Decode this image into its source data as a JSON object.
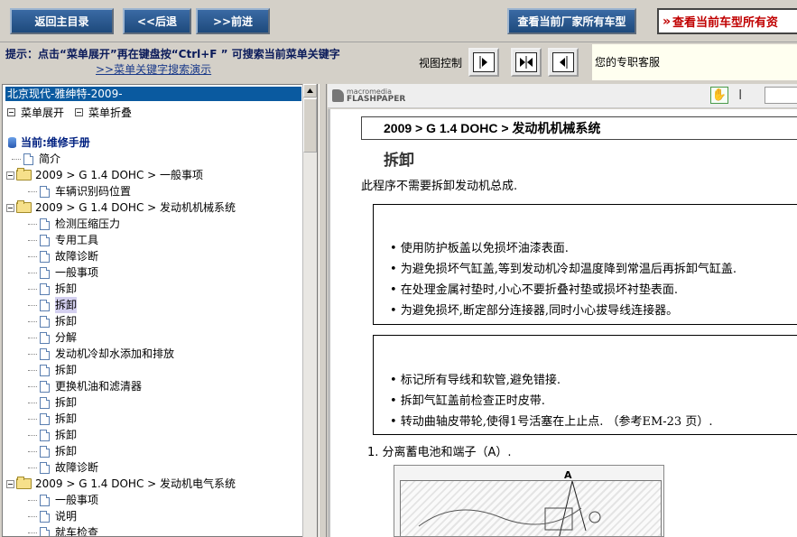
{
  "topbar": {
    "home": "返回主目录",
    "back": "<<后退",
    "forward": ">>前进",
    "all_makers": "查看当前厂家所有车型",
    "all_models": "查看当前车型所有资"
  },
  "hint": {
    "text": "提示：点击“菜单展开”再在键盘按“Ctrl+F ” 可搜索当前菜单关键字",
    "link": ">>菜单关键字搜索演示"
  },
  "view_control": {
    "label": "视图控制",
    "support": "您的专职客服"
  },
  "left": {
    "title": "北京现代-雅绅特-2009-",
    "expand_all": "菜单展开",
    "collapse_all": "菜单折叠",
    "tree": [
      {
        "label": "当前:维修手册",
        "kind": "root"
      },
      {
        "label": "简介",
        "kind": "doc",
        "indent": 1
      },
      {
        "label": "2009 > G 1.4 DOHC > 一般事项",
        "kind": "folder"
      },
      {
        "label": "车辆识别码位置",
        "kind": "doc",
        "indent": 2
      },
      {
        "label": "2009 > G 1.4 DOHC > 发动机机械系统",
        "kind": "folder"
      },
      {
        "label": "检测压缩压力",
        "kind": "doc",
        "indent": 2
      },
      {
        "label": "专用工具",
        "kind": "doc",
        "indent": 2
      },
      {
        "label": "故障诊断",
        "kind": "doc",
        "indent": 2
      },
      {
        "label": "一般事项",
        "kind": "doc",
        "indent": 2
      },
      {
        "label": "拆卸",
        "kind": "doc",
        "indent": 2
      },
      {
        "label": "拆卸",
        "kind": "doc",
        "indent": 2,
        "selected": true
      },
      {
        "label": "拆卸",
        "kind": "doc",
        "indent": 2
      },
      {
        "label": "分解",
        "kind": "doc",
        "indent": 2
      },
      {
        "label": "发动机冷却水添加和排放",
        "kind": "doc",
        "indent": 2
      },
      {
        "label": "拆卸",
        "kind": "doc",
        "indent": 2
      },
      {
        "label": "更换机油和滤清器",
        "kind": "doc",
        "indent": 2
      },
      {
        "label": "拆卸",
        "kind": "doc",
        "indent": 2
      },
      {
        "label": "拆卸",
        "kind": "doc",
        "indent": 2
      },
      {
        "label": "拆卸",
        "kind": "doc",
        "indent": 2
      },
      {
        "label": "拆卸",
        "kind": "doc",
        "indent": 2
      },
      {
        "label": "故障诊断",
        "kind": "doc",
        "indent": 2
      },
      {
        "label": "2009 > G 1.4 DOHC > 发动机电气系统",
        "kind": "folder"
      },
      {
        "label": "一般事项",
        "kind": "doc",
        "indent": 2
      },
      {
        "label": "说明",
        "kind": "doc",
        "indent": 2
      },
      {
        "label": "就车检查",
        "kind": "doc",
        "indent": 2
      }
    ]
  },
  "viewer": {
    "logo_top": "macromedia",
    "logo_bottom": "FLASHPAPER",
    "section_path": "2009 > G 1.4 DOHC > 发动机机械系统",
    "heading": "拆卸",
    "intro": "此程序不需要拆卸发动机总成.",
    "note1": [
      "• 使用防护板盖以免损坏油漆表面.",
      "• 为避免损坏气缸盖,等到发动机冷却温度降到常温后再拆卸气缸盖.",
      "• 在处理金属衬垫时,小心不要折叠衬垫或损坏衬垫表面.",
      "• 为避免损坏,断定部分连接器,同时小心拔导线连接器。"
    ],
    "note2": [
      "• 标记所有导线和软管,避免错接.",
      "• 拆卸气缸盖前检查正时皮带.",
      "• 转动曲轴皮带轮,使得1号活塞在上止点. （参考EM-23 页）."
    ],
    "step1": "1. 分离蓄电池和端子（A）.",
    "figure_label": "A"
  }
}
